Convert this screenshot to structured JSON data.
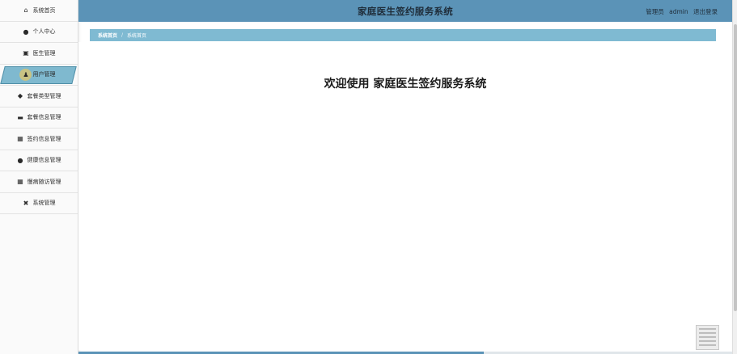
{
  "app": {
    "title": "家庭医生签约服务系统",
    "welcome": "欢迎使用 家庭医生签约服务系统"
  },
  "header": {
    "user_role": "管理员",
    "user_name": "admin",
    "logout_label": "退出登录"
  },
  "breadcrumb": {
    "home": "系统首页",
    "separator": "/",
    "current": "系统首页"
  },
  "sidebar": {
    "items": [
      {
        "label": "系统首页",
        "icon": "home-icon",
        "glyph": "⌂"
      },
      {
        "label": "个人中心",
        "icon": "user-icon",
        "glyph": "●"
      },
      {
        "label": "医生管理",
        "icon": "clipboard-icon",
        "glyph": "▣"
      },
      {
        "label": "用户管理",
        "icon": "users-icon",
        "glyph": "♟",
        "active": true
      },
      {
        "label": "套餐类型管理",
        "icon": "location-pin-icon",
        "glyph": "◆"
      },
      {
        "label": "套餐信息管理",
        "icon": "monitor-icon",
        "glyph": "▬"
      },
      {
        "label": "签约信息管理",
        "icon": "grid-icon",
        "glyph": "▦"
      },
      {
        "label": "健康信息管理",
        "icon": "person-icon",
        "glyph": "●"
      },
      {
        "label": "慢病随访管理",
        "icon": "apps-icon",
        "glyph": "▦"
      },
      {
        "label": "系统管理",
        "icon": "settings-icon",
        "glyph": "✖"
      }
    ]
  },
  "colors": {
    "header_bg": "#5b93b7",
    "breadcrumb_bg": "#7fbad2",
    "active_item_bg": "#7fb9cf"
  },
  "progress": {
    "fraction": 0.62
  }
}
